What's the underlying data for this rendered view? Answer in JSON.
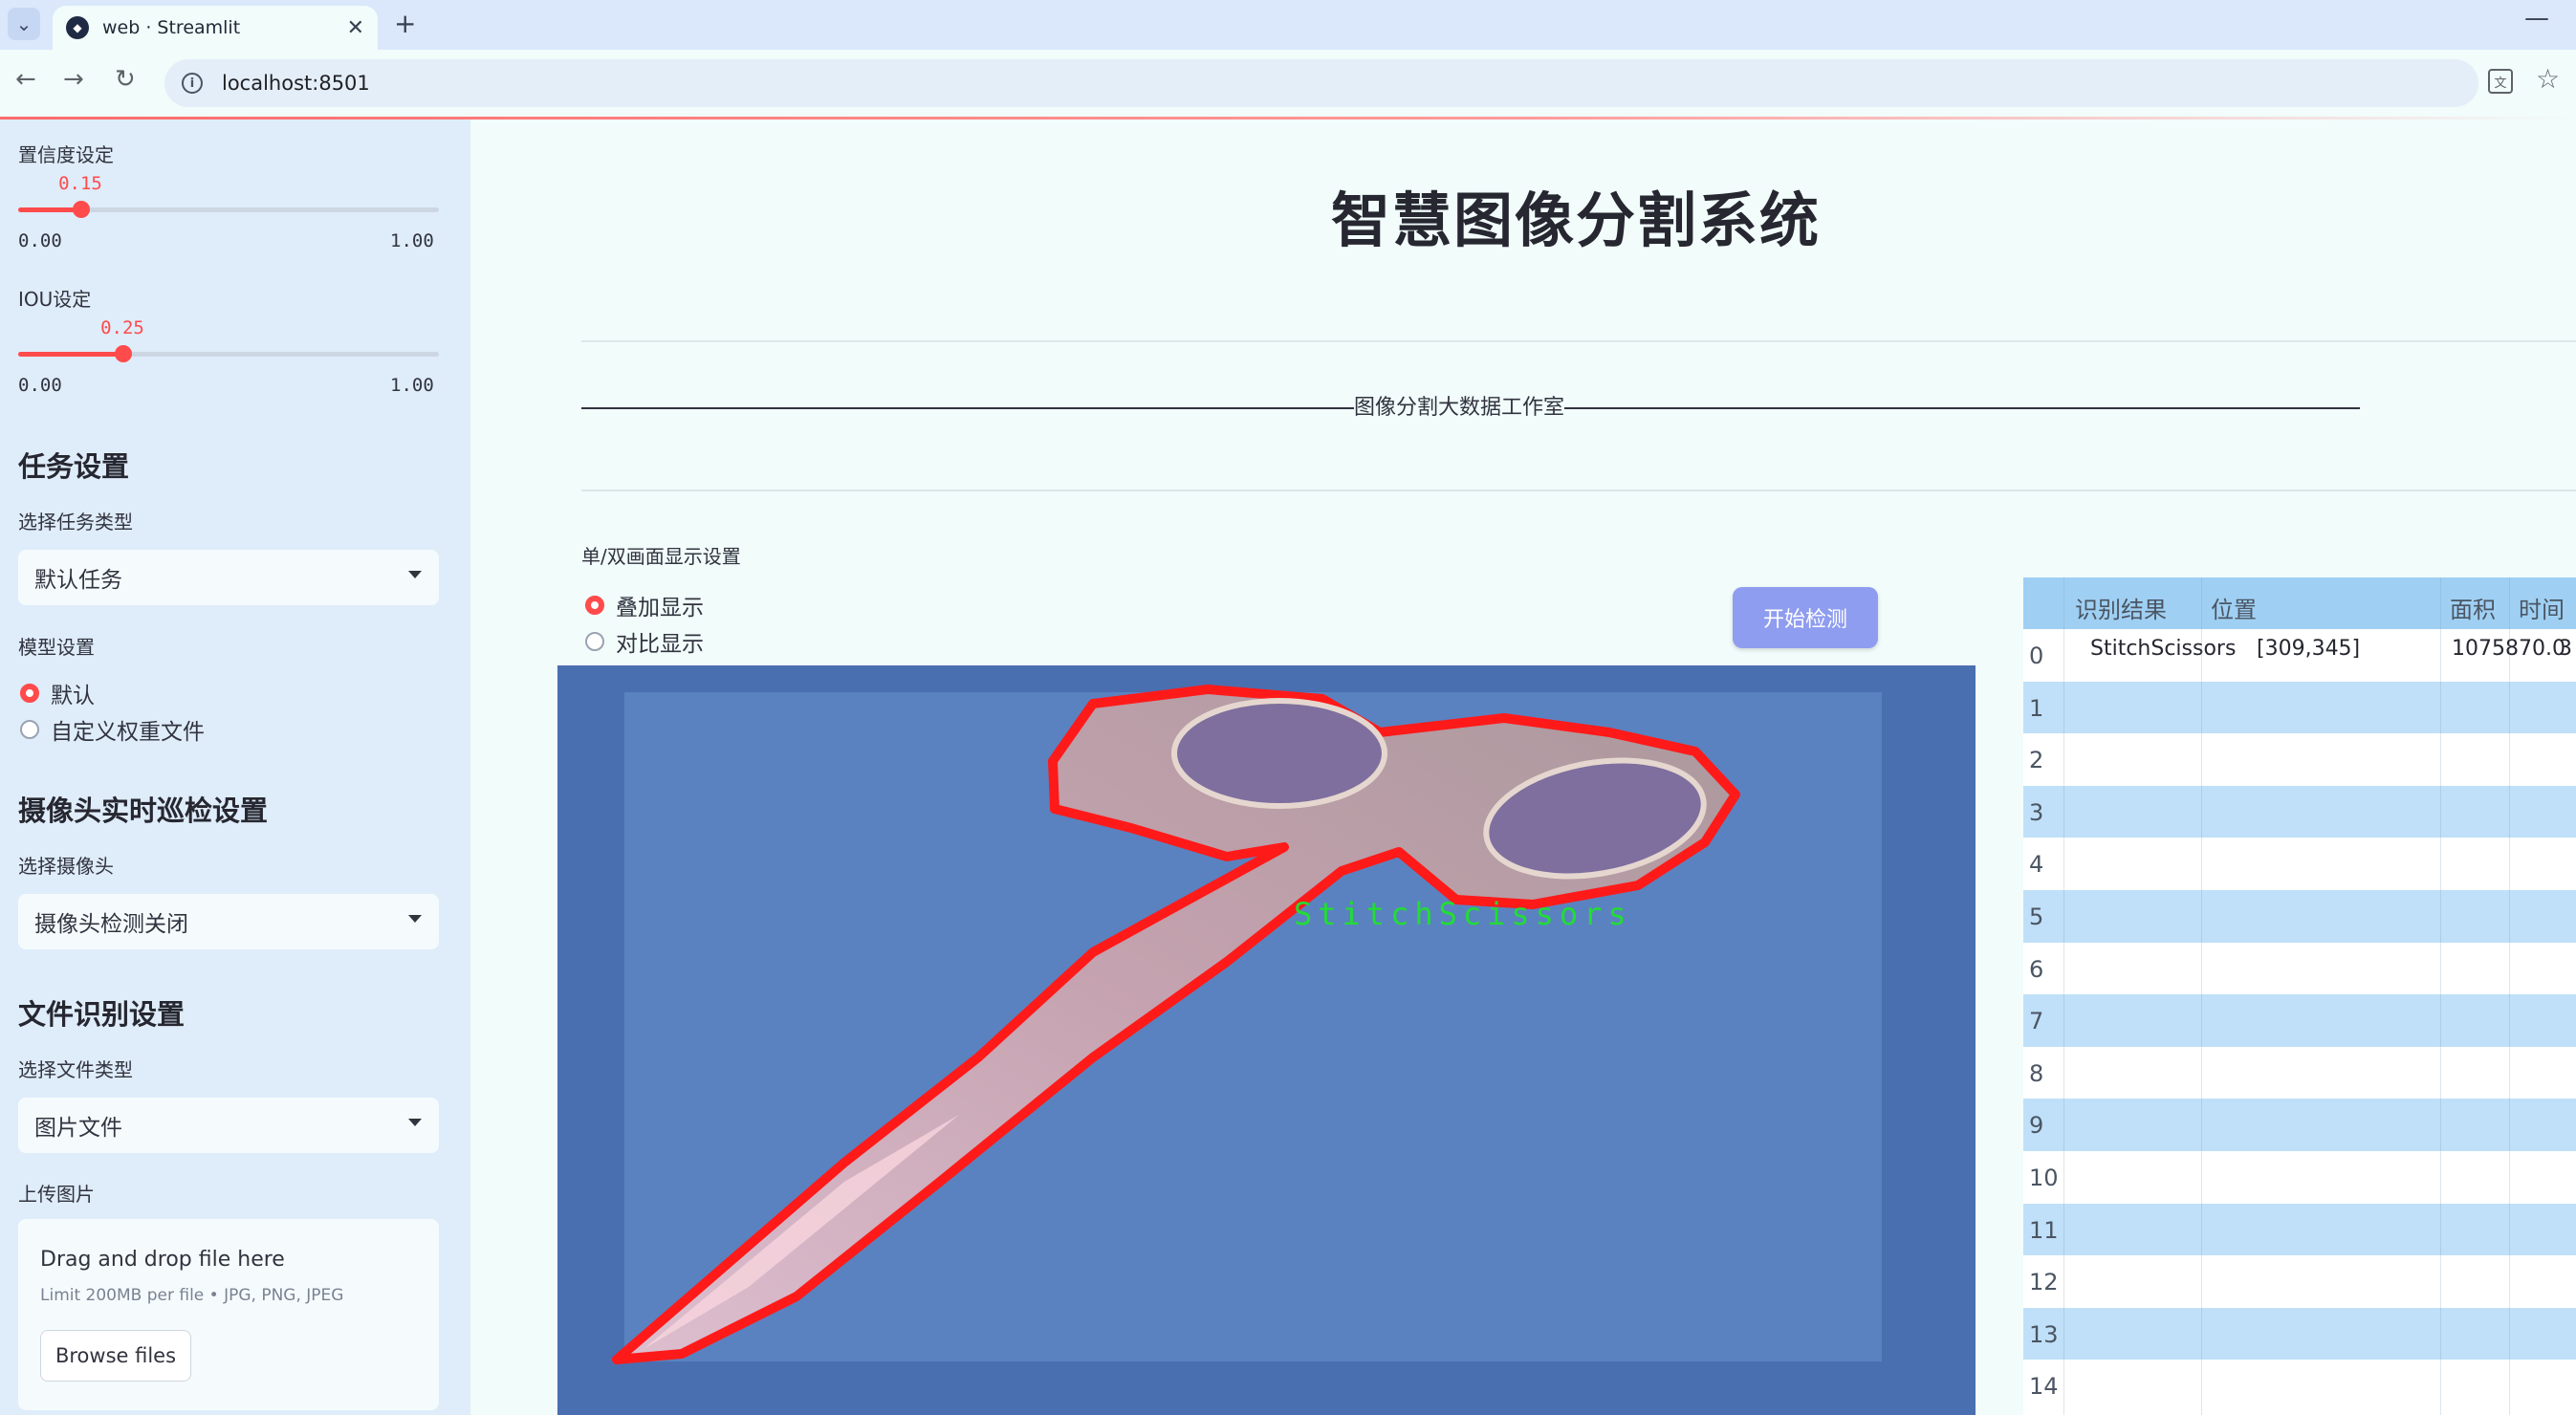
{
  "browser": {
    "tab_title": "web · Streamlit",
    "url": "localhost:8501"
  },
  "sidebar": {
    "confidence": {
      "label": "置信度设定",
      "value_text": "0.15",
      "value": 0.15,
      "min": "0.00",
      "max": "1.00"
    },
    "iou": {
      "label": "IOU设定",
      "value_text": "0.25",
      "value": 0.25,
      "min": "0.00",
      "max": "1.00"
    },
    "task_heading": "任务设置",
    "task_type_label": "选择任务类型",
    "task_type_value": "默认任务",
    "model_label": "模型设置",
    "model_options": [
      "默认",
      "自定义权重文件"
    ],
    "camera_heading": "摄像头实时巡检设置",
    "camera_label": "选择摄像头",
    "camera_value": "摄像头检测关闭",
    "file_heading": "文件识别设置",
    "file_type_label": "选择文件类型",
    "file_type_value": "图片文件",
    "upload_label": "上传图片",
    "uploader": {
      "title": "Drag and drop file here",
      "subtitle": "Limit 200MB per file • JPG, PNG, JPEG",
      "button": "Browse files"
    }
  },
  "main": {
    "title": "智慧图像分割系统",
    "studio": "图像分割大数据工作室",
    "display_label": "单/双画面显示设置",
    "display_options": [
      "叠加显示",
      "对比显示"
    ],
    "start_button": "开始检测",
    "detection_label": "StitchScissors",
    "colors": {
      "mask_outline": "#ff1a1a",
      "label_text": "#22dd33",
      "accent": "#ff4b4b"
    }
  },
  "table": {
    "columns": [
      "识别结果",
      "位置",
      "面积",
      "时间"
    ],
    "rows": [
      {
        "idx": "0",
        "result": "StitchScissors",
        "position": "[309,345]",
        "area": "1075870.0",
        "time": "3"
      },
      {
        "idx": "1"
      },
      {
        "idx": "2"
      },
      {
        "idx": "3"
      },
      {
        "idx": "4"
      },
      {
        "idx": "5"
      },
      {
        "idx": "6"
      },
      {
        "idx": "7"
      },
      {
        "idx": "8"
      },
      {
        "idx": "9"
      },
      {
        "idx": "10"
      },
      {
        "idx": "11"
      },
      {
        "idx": "12"
      },
      {
        "idx": "13"
      },
      {
        "idx": "14"
      }
    ]
  }
}
